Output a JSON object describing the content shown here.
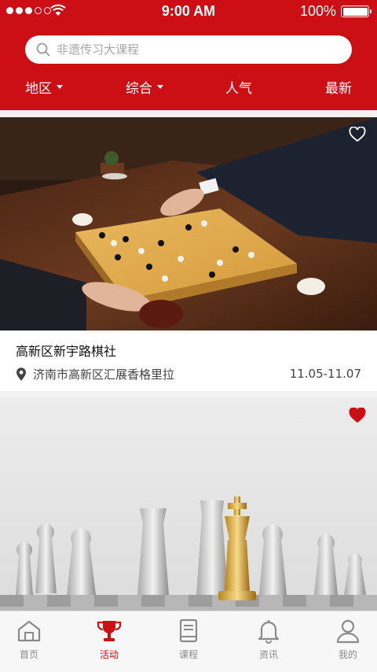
{
  "status_bar": {
    "time": "9:00 AM",
    "battery": "100%"
  },
  "search": {
    "placeholder": "非遗传习大课程"
  },
  "filters": [
    {
      "label": "地区",
      "has_dropdown": true
    },
    {
      "label": "综合",
      "has_dropdown": true
    },
    {
      "label": "人气",
      "has_dropdown": false
    },
    {
      "label": "最新",
      "has_dropdown": false
    }
  ],
  "cards": [
    {
      "title": "高新区新宇路棋社",
      "location": "济南市高新区汇展香格里拉",
      "date": "11.05-11.07",
      "favorited": false,
      "image": "go-board-photo"
    },
    {
      "title": "",
      "location": "",
      "date": "",
      "favorited": true,
      "image": "chess-pieces-photo"
    }
  ],
  "tabs": [
    {
      "label": "首页",
      "icon": "home-icon",
      "active": false
    },
    {
      "label": "活动",
      "icon": "trophy-icon",
      "active": true
    },
    {
      "label": "课程",
      "icon": "book-icon",
      "active": false
    },
    {
      "label": "资讯",
      "icon": "bell-icon",
      "active": false
    },
    {
      "label": "我的",
      "icon": "user-icon",
      "active": false
    }
  ],
  "colors": {
    "brand_red": "#cc0f14",
    "tab_inactive": "#8a8a8a",
    "background": "#f2f2f2"
  }
}
